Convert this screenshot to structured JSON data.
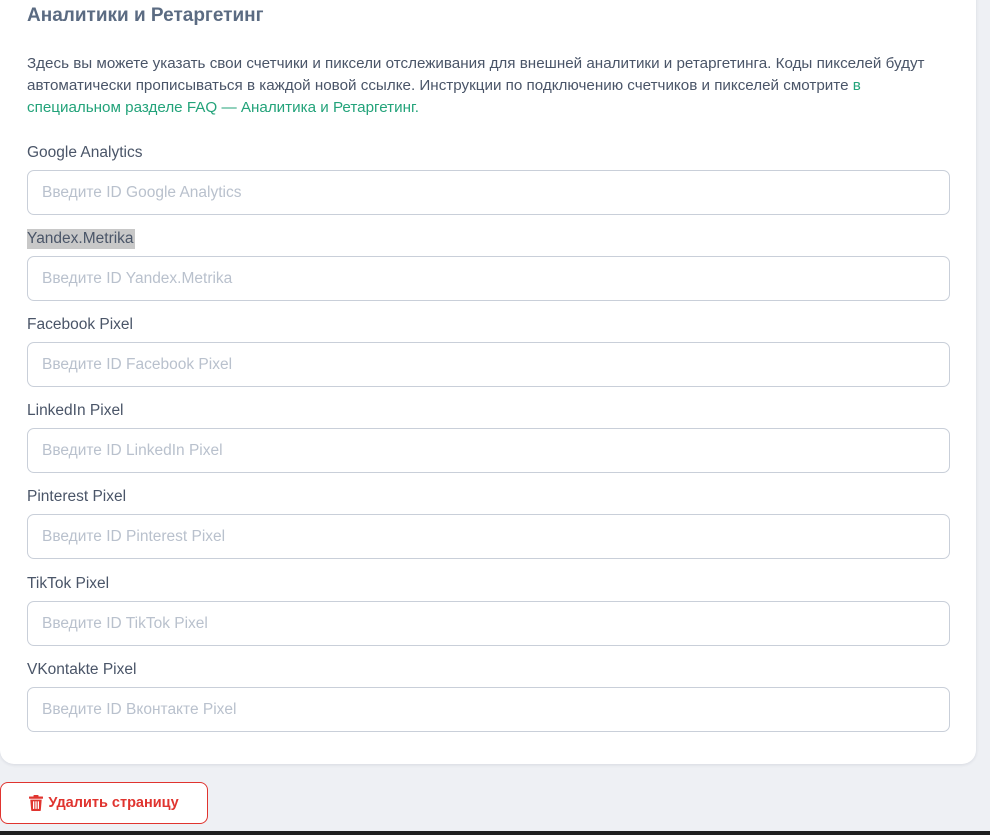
{
  "section": {
    "title": "Аналитики и Ретаргетинг",
    "description": "Здесь вы можете указать свои счетчики и пиксели отслеживания для внешней аналитики и ретаргетинга. Коды пикселей будут автоматически прописываться в каждой новой ссылке. Инструкции по подключению счетчиков и пикселей смотрите ",
    "faq_link": "в специальном разделе FAQ — Аналитика и Ретаргетинг."
  },
  "fields": [
    {
      "label": "Google Analytics",
      "placeholder": "Введите ID Google Analytics",
      "value": ""
    },
    {
      "label": "Yandex.Metrika",
      "placeholder": "Введите ID Yandex.Metrika",
      "value": ""
    },
    {
      "label": "Facebook Pixel",
      "placeholder": "Введите ID Facebook Pixel",
      "value": ""
    },
    {
      "label": "LinkedIn Pixel",
      "placeholder": "Введите ID LinkedIn Pixel",
      "value": ""
    },
    {
      "label": "Pinterest Pixel",
      "placeholder": "Введите ID Pinterest Pixel",
      "value": ""
    },
    {
      "label": "TikTok Pixel",
      "placeholder": "Введите ID TikTok Pixel",
      "value": ""
    },
    {
      "label": "VKontakte Pixel",
      "placeholder": "Введите ID Вконтакте Pixel",
      "value": ""
    }
  ],
  "actions": {
    "delete_label": "Удалить страницу",
    "delete_icon": "trash-icon"
  },
  "colors": {
    "link": "#23a37a",
    "danger": "#e0342f"
  }
}
